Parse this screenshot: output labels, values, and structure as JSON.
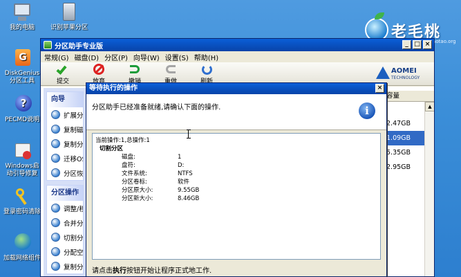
{
  "desktop": {
    "icons": [
      {
        "label": "我的电脑",
        "icon": "computer-icon"
      },
      {
        "label": "识别苹果分区",
        "icon": "drive-icon"
      },
      {
        "label": "DiskGenius分区工具",
        "icon": "diskgenius-icon"
      },
      {
        "label": "PECMD说明",
        "icon": "help-icon"
      },
      {
        "label": "Windows启动引导修复",
        "icon": "repair-icon"
      },
      {
        "label": "登录密码清除",
        "icon": "key-icon"
      },
      {
        "label": "加载网络组件",
        "icon": "network-icon"
      }
    ],
    "brand_text": "老毛桃",
    "brand_url": "www.laomaotao.org"
  },
  "window": {
    "title": "分区助手专业版",
    "menu": [
      "常规(G)",
      "磁盘(D)",
      "分区(P)",
      "向导(W)",
      "设置(S)",
      "帮助(H)"
    ],
    "toolbar": [
      "提交",
      "放弃",
      "撤销",
      "重做",
      "刷新"
    ],
    "vendor": {
      "name": "AOMEI",
      "sub": "TECHNOLOGY"
    },
    "wizard_group": {
      "title": "向导",
      "items": [
        "扩展分区向导",
        "复制磁盘向导",
        "复制分区向导",
        "迁移OS到SSD",
        "分区恢复向导"
      ]
    },
    "partition_group": {
      "title": "分区操作",
      "items": [
        "调整/移动分区",
        "合并分区",
        "切割分区",
        "分配空闲空间",
        "复制分区"
      ]
    },
    "right_column": {
      "header": "容量",
      "rows": [
        "2.47GB",
        "1.09GB",
        "5.35GB",
        "2.95GB"
      ],
      "selected_index": 1
    }
  },
  "dialog": {
    "title": "等待执行的操作",
    "message": "分区助手已经准备就绪,请确认下面的操作.",
    "op_header": "当前操作:1,总操作:1",
    "op_title": "切割分区",
    "fields": [
      {
        "key": "磁盘:",
        "value": "1"
      },
      {
        "key": "盘符:",
        "value": "D:"
      },
      {
        "key": "文件系统:",
        "value": "NTFS"
      },
      {
        "key": "分区卷标:",
        "value": "软件"
      },
      {
        "key": "分区原大小:",
        "value": "9.55GB"
      },
      {
        "key": "分区新大小:",
        "value": "8.46GB"
      }
    ],
    "footer_pre": "请点击",
    "footer_bold": "执行",
    "footer_post": "按钮开始让程序正式地工作."
  }
}
